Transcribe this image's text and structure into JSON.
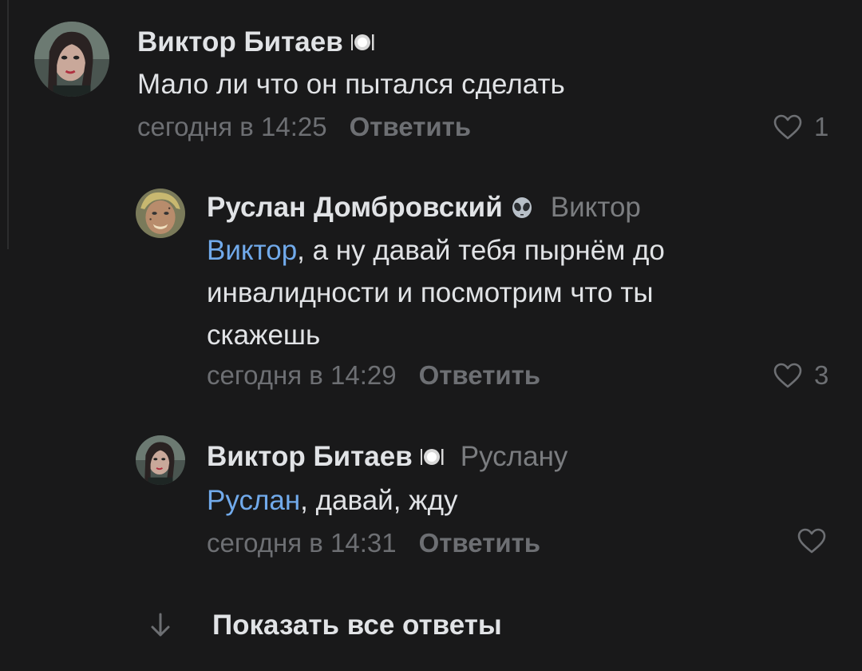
{
  "comments": [
    {
      "author": "Виктор Битаев",
      "badge_icon": "plate-cutlery-icon",
      "reply_to": "",
      "mention": "",
      "text": "Мало ли что он пытался сделать",
      "time": "сегодня в 14:25",
      "reply_label": "Ответить",
      "likes": "1"
    },
    {
      "author": "Руслан Домбровский",
      "badge_icon": "alien-icon",
      "reply_to": "Виктор",
      "mention": "Виктор",
      "text": ", а ну давай тебя пырнём до инвалидности и посмотрим что ты скажешь",
      "time": "сегодня в 14:29",
      "reply_label": "Ответить",
      "likes": "3"
    },
    {
      "author": "Виктор Битаев",
      "badge_icon": "plate-cutlery-icon",
      "reply_to": "Руслану",
      "mention": "Руслан",
      "text": ", давай, жду",
      "time": "сегодня в 14:31",
      "reply_label": "Ответить",
      "likes": ""
    }
  ],
  "show_all_label": "Показать все ответы",
  "colors": {
    "background": "#19191a",
    "text": "#e1e3e6",
    "secondary": "#6d6f73",
    "mention": "#71aaeb"
  }
}
